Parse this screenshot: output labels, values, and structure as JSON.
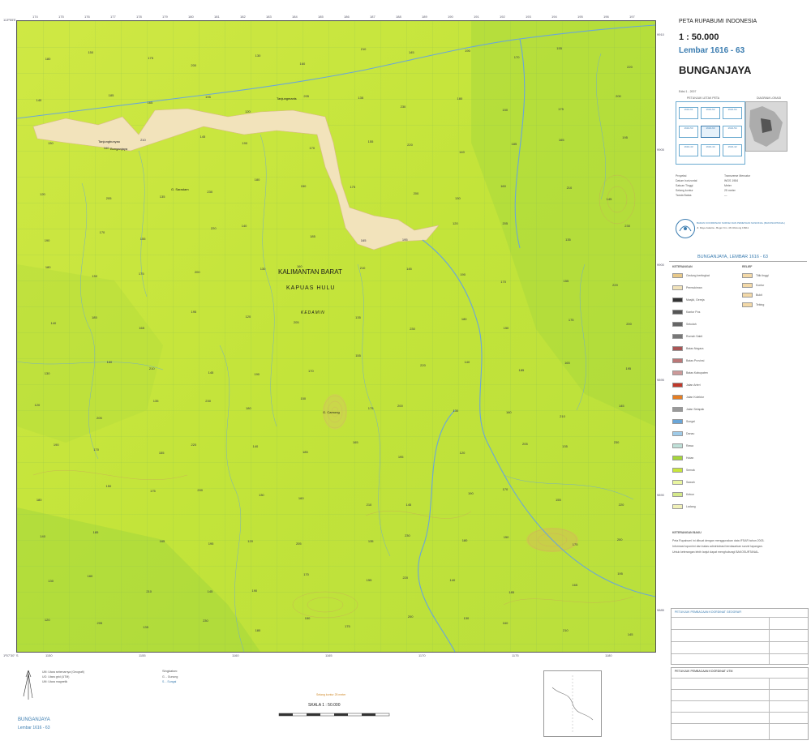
{
  "header": {
    "series": "PETA RUPABUMI INDONESIA",
    "scale": "1 : 50.000",
    "sheet": "Lembar 1616 - 63",
    "name": "BUNGANJAYA",
    "edition": "Edisi 1 - 2007"
  },
  "map": {
    "region_label": "KALIMANTAN BARAT",
    "district_label": "KAPUAS HULU",
    "subdistrict_label": "KEDAMIN",
    "places": [
      "Tanjungbunyau",
      "Bunganjaya",
      "G. Saradam",
      "Tanjungmanis",
      "G. Carnong"
    ],
    "corner_top_left": "113º55'E",
    "corner_bottom_left": "1º07'30\" S",
    "top_ticks": [
      "174",
      "175",
      "176",
      "177",
      "178",
      "179",
      "180",
      "181",
      "182",
      "183",
      "184",
      "185",
      "186",
      "187",
      "188",
      "189",
      "190",
      "191",
      "192",
      "193",
      "194",
      "195",
      "196",
      "197"
    ],
    "bottom_ticks": [
      "1150",
      "1155",
      "1160",
      "1165",
      "1170",
      "1175",
      "1180"
    ],
    "right_ticks": [
      "9910",
      "9905",
      "9900",
      "9895",
      "9890",
      "9885"
    ],
    "spot_heights": [
      "180",
      "150",
      "175",
      "200",
      "130",
      "160",
      "210",
      "145",
      "190",
      "170",
      "155",
      "220",
      "140",
      "185",
      "165",
      "195",
      "120",
      "205",
      "135",
      "230"
    ]
  },
  "sidebar": {
    "index_title": "PETUNJUK LETAK PETA",
    "admin_title": "DIAGRAM LOKASI",
    "index_cells": [
      "1616-61",
      "1616-62",
      "1616-64",
      "1616-53",
      "1616-63",
      "1616-54",
      "1616-43",
      "1616-44",
      "1616-42"
    ],
    "info_labels": [
      "Proyeksi",
      "Datum horizontal",
      "Satuan Tinggi",
      "Selang kontur",
      "Tanda Batas"
    ],
    "info_values": [
      "Transverse Mercator",
      "WGS 1984",
      "Meter",
      "25 meter",
      "—"
    ],
    "publisher": "BADAN KOORDINASI SURVEI DAN PEMETAAN NASIONAL (BAKOSURTANAL)",
    "publisher_address": "Jl. Raya Jakarta - Bogor Km. 46 Cibinong 16911",
    "legend_sheet_label": "BUNGANJAYA, LEMBAR 1616 - 63",
    "legend_title": "KETERANGAN",
    "legend_items": [
      "Gedung bertingkat",
      "Permukiman",
      "Masjid, Gereja",
      "Kantor Pos",
      "Sekolah",
      "Rumah Sakit",
      "Batas Negara",
      "Batas Provinsi",
      "Batas Kabupaten",
      "Jalan Arteri",
      "Jalan Kolektor",
      "Jalan Setapak",
      "Sungai",
      "Danau",
      "Rawa",
      "Hutan",
      "Semak",
      "Sawah",
      "Kebun",
      "Ladang"
    ],
    "relief_title": "RELIEF",
    "relief_items": [
      "Titik tinggi",
      "Kontur",
      "Bukit",
      "Tebing"
    ],
    "notes_title": "KETERANGAN BAKU",
    "notes": [
      "Peta Rupabumi ini dibuat dengan menggunakan data IFSAR tahun 2003.",
      "Informasi toponimi dan batas administrasi berdasarkan survei lapangan.",
      "Untuk keterangan lebih lanjut dapat menghubungi BAKOSURTANAL."
    ],
    "table_title": "PETUNJUK PEMBACAAN KOORDINAT GEOGRAFI",
    "table_title_2": "PETUNJUK PEMBACAAN KOORDINAT UTM"
  },
  "bottom": {
    "left_notes": [
      "UM: Utara sebenarnya (Geografi)",
      "UG: Utara grid (UTM)",
      "UM: Utara magnetik"
    ],
    "abbrev_title": "Singkatan:",
    "abbrev_items": [
      "G. - Gunung",
      "S. - Sungai"
    ],
    "scale_label": "SKALA 1 : 50.000",
    "contour_note": "Selang kontur 25 meter",
    "footer_name": "BUNGANJAYA",
    "footer_sheet": "Lembar 1616 - 63"
  },
  "colors": {
    "map_green": "#c8e63c",
    "forest_green": "#a6d63a",
    "settlement": "#f2e3bb",
    "river": "#6aa6d8",
    "contour": "#c9a25c",
    "accent_blue": "#3a7cb0"
  }
}
